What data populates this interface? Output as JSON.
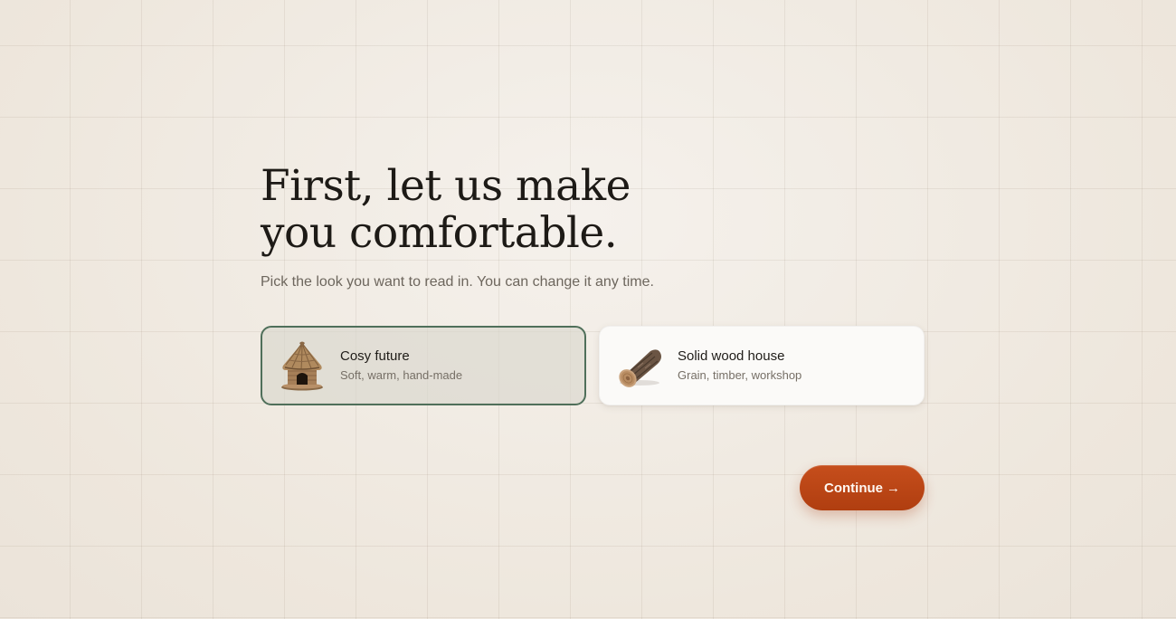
{
  "page": {
    "headline": "First, let us make you comfortable.",
    "subtitle": "Pick the look you want to read in. You can change it any time."
  },
  "options": [
    {
      "title": "Cosy future",
      "description": "Soft, warm, hand-made",
      "icon": "thatched-hut-icon",
      "selected": true
    },
    {
      "title": "Solid wood house",
      "description": "Grain, timber, workshop",
      "icon": "wood-log-icon",
      "selected": false
    }
  ],
  "actions": {
    "continue_label": "Continue",
    "continue_arrow": "→"
  },
  "colors": {
    "accent": "#b8441a",
    "selected_border": "#4f6f5a",
    "background": "#f1ebe3"
  }
}
